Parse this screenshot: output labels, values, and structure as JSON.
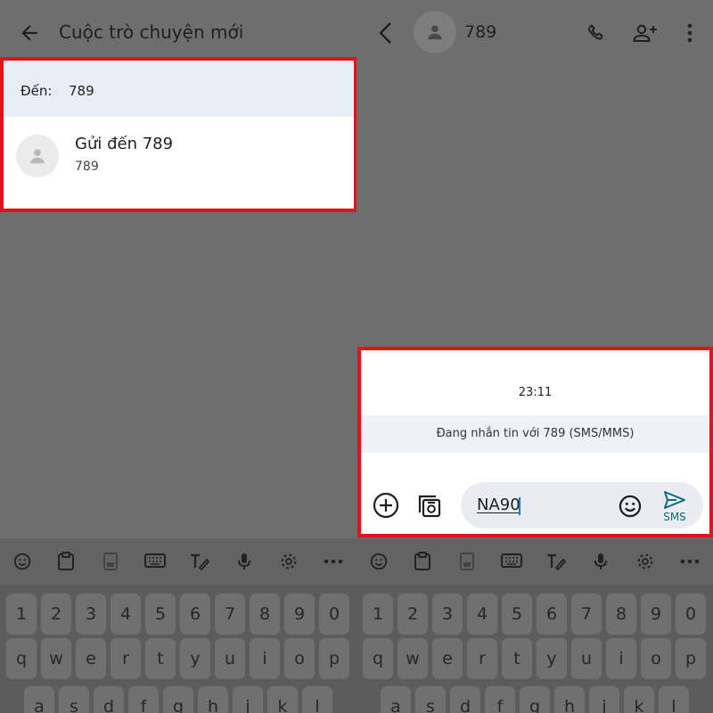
{
  "left": {
    "title": "Cuộc trò chuyện mới",
    "to_label": "Đến:",
    "to_value": "789",
    "suggestion": {
      "title": "Gửi đến 789",
      "subtitle": "789"
    }
  },
  "right": {
    "contact_name": "789",
    "timestamp": "23:11",
    "info": "Đang nhắn tin với 789 (SMS/MMS)",
    "message_text": "NA90",
    "send_label": "SMS"
  },
  "keyboard": {
    "tools": [
      "emoji-icon",
      "clipboard-icon",
      "one-handed-icon",
      "keyboard-icon",
      "handwriting-icon",
      "mic-icon",
      "settings-icon",
      "more-icon"
    ],
    "numbers": [
      "1",
      "2",
      "3",
      "4",
      "5",
      "6",
      "7",
      "8",
      "9",
      "0"
    ],
    "row_q": [
      "q",
      "w",
      "e",
      "r",
      "t",
      "y",
      "u",
      "i",
      "o",
      "p"
    ],
    "row_a": [
      "a",
      "s",
      "d",
      "f",
      "g",
      "h",
      "j",
      "k",
      "l"
    ]
  },
  "colors": {
    "highlight": "#e1141c",
    "send": "#0b6c7c",
    "caret": "#1a73e8"
  }
}
